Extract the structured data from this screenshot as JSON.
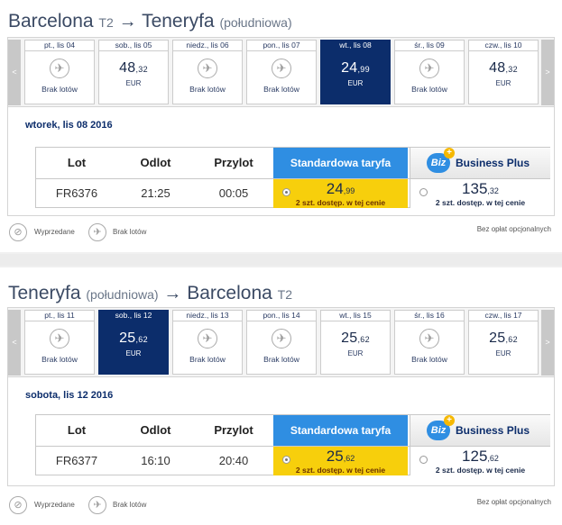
{
  "outbound": {
    "title_from": "Barcelona",
    "title_from_suffix": "T2",
    "title_arrow": "→",
    "title_to": "Teneryfa",
    "title_to_suffix": "(południowa)",
    "days": [
      {
        "label": "pt., lis 04",
        "no_flight": true,
        "no_flight_text": "Brak lotów"
      },
      {
        "label": "sob., lis 05",
        "price_main": "48",
        "price_cents": ",32",
        "currency": "EUR"
      },
      {
        "label": "niedz., lis 06",
        "no_flight": true,
        "no_flight_text": "Brak lotów"
      },
      {
        "label": "pon., lis 07",
        "no_flight": true,
        "no_flight_text": "Brak lotów"
      },
      {
        "label": "wt., lis 08",
        "price_main": "24",
        "price_cents": ",99",
        "currency": "EUR",
        "selected": true
      },
      {
        "label": "śr., lis 09",
        "no_flight": true,
        "no_flight_text": "Brak lotów"
      },
      {
        "label": "czw., lis 10",
        "price_main": "48",
        "price_cents": ",32",
        "currency": "EUR"
      }
    ],
    "selected_date": "wtorek, lis 08 2016",
    "table": {
      "col_flight": "Lot",
      "col_departure": "Odlot",
      "col_arrival": "Przylot",
      "col_standard": "Standardowa taryfa",
      "col_business": "Business Plus",
      "flight": "FR6376",
      "departure": "21:25",
      "arrival": "00:05",
      "standard_price_main": "24",
      "standard_price_cents": ",99",
      "standard_avail": "2 szt. dostęp. w tej cenie",
      "business_price_main": "135",
      "business_price_cents": ",32",
      "business_avail": "2 szt. dostęp. w tej cenie"
    },
    "legend": {
      "sold_out": "Wyprzedane",
      "no_flights": "Brak lotów",
      "right": "Bez opłat opcjonalnych"
    }
  },
  "inbound": {
    "title_from": "Teneryfa",
    "title_from_suffix": "(południowa)",
    "title_arrow": "→",
    "title_to": "Barcelona",
    "title_to_suffix": "T2",
    "days": [
      {
        "label": "pt., lis 11",
        "no_flight": true,
        "no_flight_text": "Brak lotów"
      },
      {
        "label": "sob., lis 12",
        "price_main": "25",
        "price_cents": ",62",
        "currency": "EUR",
        "selected": true
      },
      {
        "label": "niedz., lis 13",
        "no_flight": true,
        "no_flight_text": "Brak lotów"
      },
      {
        "label": "pon., lis 14",
        "no_flight": true,
        "no_flight_text": "Brak lotów"
      },
      {
        "label": "wt., lis 15",
        "price_main": "25",
        "price_cents": ",62",
        "currency": "EUR"
      },
      {
        "label": "śr., lis 16",
        "no_flight": true,
        "no_flight_text": "Brak lotów"
      },
      {
        "label": "czw., lis 17",
        "price_main": "25",
        "price_cents": ",62",
        "currency": "EUR"
      }
    ],
    "selected_date": "sobota, lis 12 2016",
    "table": {
      "col_flight": "Lot",
      "col_departure": "Odlot",
      "col_arrival": "Przylot",
      "col_standard": "Standardowa taryfa",
      "col_business": "Business Plus",
      "flight": "FR6377",
      "departure": "16:10",
      "arrival": "20:40",
      "standard_price_main": "25",
      "standard_price_cents": ",62",
      "standard_avail": "2 szt. dostęp. w tej cenie",
      "business_price_main": "125",
      "business_price_cents": ",62",
      "business_avail": "2 szt. dostęp. w tej cenie"
    },
    "legend": {
      "sold_out": "Wyprzedane",
      "no_flights": "Brak lotów",
      "right": "Bez opłat opcjonalnych"
    }
  },
  "business_logo_text": "Biz",
  "business_logo_plus": "+",
  "nav_prev": "<",
  "nav_next": ">",
  "colors": {
    "selected_day": "#0c2d6b",
    "standard_header": "#2f8ee2",
    "standard_fare": "#f7cf0c"
  }
}
